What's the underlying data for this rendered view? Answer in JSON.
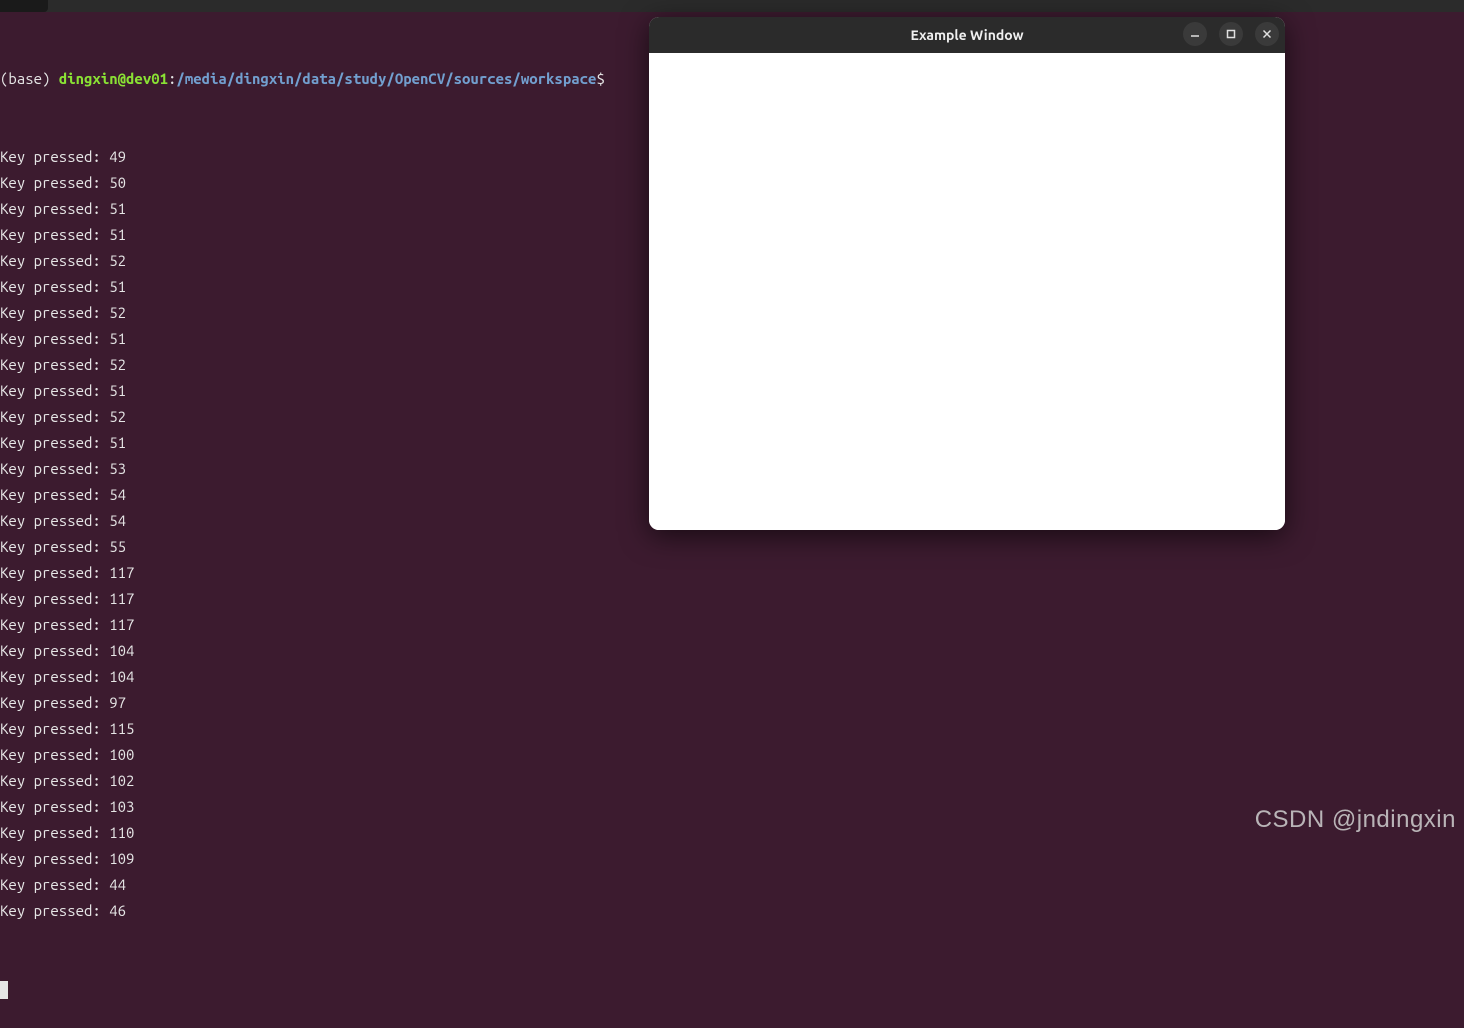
{
  "prompt": {
    "env": "(base) ",
    "user": "dingxin@dev01",
    "colon": ":",
    "path": "/media/dingxin/data/study/OpenCV/sources/workspace",
    "dollar": "$"
  },
  "output_label": "Key pressed: ",
  "values": [
    49,
    50,
    51,
    51,
    52,
    51,
    52,
    51,
    52,
    51,
    52,
    51,
    53,
    54,
    54,
    55,
    117,
    117,
    117,
    104,
    104,
    97,
    115,
    100,
    102,
    103,
    110,
    109,
    44,
    46
  ],
  "window": {
    "title": "Example Window"
  },
  "watermark": "CSDN @jndingxin"
}
